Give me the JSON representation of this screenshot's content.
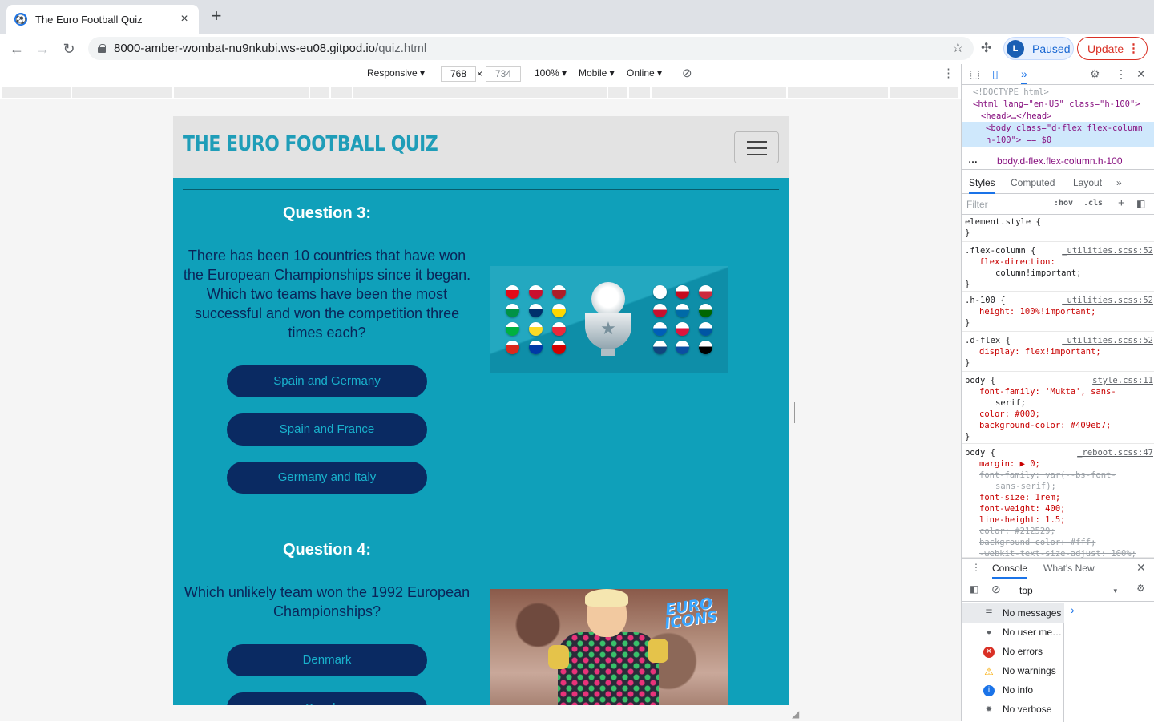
{
  "browser": {
    "tab_title": "The Euro Football Quiz",
    "new_tab": "+",
    "url_host": "8000-amber-wombat-nu9nkubi.ws-eu08.gitpod.io",
    "url_path": "/quiz.html",
    "profile_initial": "L",
    "profile_label": "Paused",
    "update_label": "Update"
  },
  "device_toolbar": {
    "device": "Responsive ▾",
    "width": "768",
    "times": "×",
    "height": "734",
    "zoom": "100% ▾",
    "mode": "Mobile ▾",
    "network": "Online ▾"
  },
  "site": {
    "brand": "THE EURO FOOTBALL QUIZ",
    "accent": "#409eb7",
    "content_bg": "#0fa0ba",
    "answer_bg": "#0a2a62",
    "questions": [
      {
        "heading": "Question 3:",
        "text": "There has been 10 countries that have won the European Championships since it began. Which two teams have been the most successful and won the competition three times each?",
        "answers": [
          "Spain and Germany",
          "Spain and France",
          "Germany and Italy"
        ]
      },
      {
        "heading": "Question 4:",
        "text": "Which unlikely team won the 1992 European Championships?",
        "answers": [
          "Denmark",
          "Sweden"
        ]
      }
    ],
    "photo_logo": "EURO ICONS"
  },
  "devtools": {
    "elements": [
      "<!DOCTYPE html>",
      "<html lang=\"en-US\" class=\"h-100\">",
      "<head>…</head>",
      "<body class=\"d-flex flex-column h-100\"> == $0"
    ],
    "breadcrumb": "body.d-flex.flex-column.h-100",
    "style_tabs": [
      "Styles",
      "Computed",
      "Layout"
    ],
    "filter_placeholder": "Filter",
    "hov": ":hov",
    "cls": ".cls",
    "rules": [
      {
        "selector": "element.style {",
        "source": "",
        "lines": [
          "}"
        ]
      },
      {
        "selector": ".flex-column {",
        "source": "_utilities.scss:52",
        "lines": [
          "flex-direction:",
          "column!important;",
          "}"
        ]
      },
      {
        "selector": ".h-100 {",
        "source": "_utilities.scss:52",
        "lines": [
          "height: 100%!important;",
          "}"
        ]
      },
      {
        "selector": ".d-flex {",
        "source": "_utilities.scss:52",
        "lines": [
          "display: flex!important;",
          "}"
        ]
      },
      {
        "selector": "body {",
        "source": "style.css:11",
        "lines": [
          "font-family: 'Mukta', sans-",
          "serif;",
          "color: #000;",
          "background-color: #409eb7;",
          "}"
        ]
      },
      {
        "selector": "body {",
        "source": "_reboot.scss:47",
        "lines": [
          "margin: ▶ 0;",
          "font-family: var(--bs-font-",
          "sans-serif);",
          "font-size: 1rem;",
          "font-weight: 400;",
          "line-height: 1.5;",
          "color: #212529;",
          "background-color: #fff;",
          "-webkit-text-size-adjust: 100%;"
        ]
      }
    ],
    "console_tabs": [
      "Console",
      "What's New"
    ],
    "context": "top",
    "console_filters": [
      {
        "icon": "list-icon",
        "label": "No messages",
        "color": "#5f6368"
      },
      {
        "icon": "user-icon",
        "label": "No user me…",
        "color": "#5f6368"
      },
      {
        "icon": "error-icon",
        "label": "No errors",
        "color": "#d93025"
      },
      {
        "icon": "warning-icon",
        "label": "No warnings",
        "color": "#f9ab00"
      },
      {
        "icon": "info-icon",
        "label": "No info",
        "color": "#1a73e8"
      },
      {
        "icon": "verbose-icon",
        "label": "No verbose",
        "color": "#5f6368"
      }
    ]
  }
}
